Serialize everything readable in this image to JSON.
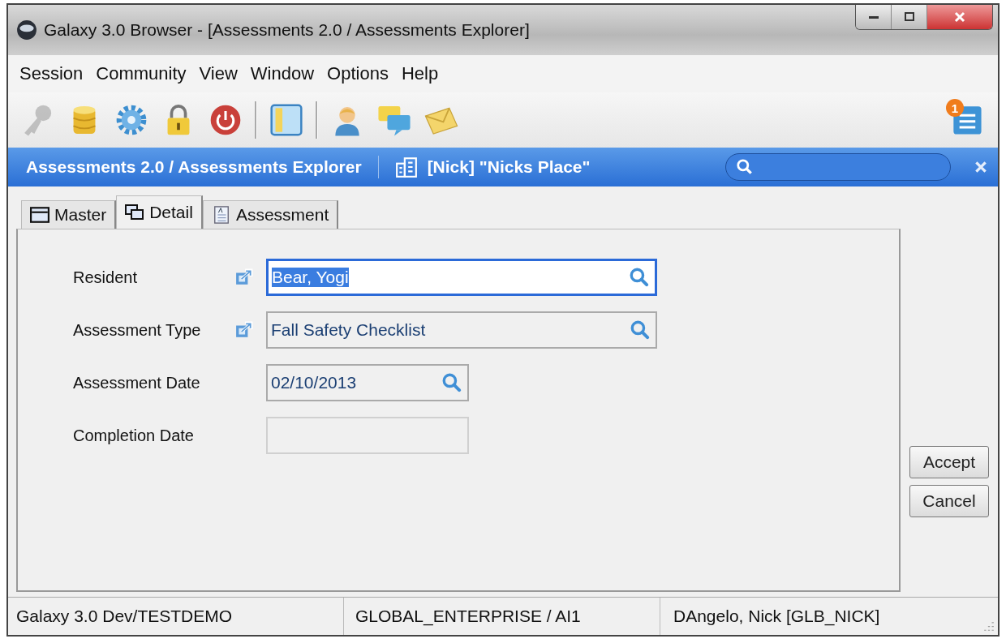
{
  "window": {
    "title": "Galaxy 3.0 Browser - [Assessments 2.0 / Assessments Explorer]"
  },
  "menu": [
    "Session",
    "Community",
    "View",
    "Window",
    "Options",
    "Help"
  ],
  "toolbar": [
    {
      "kind": "key",
      "disabled": true
    },
    {
      "kind": "database",
      "disabled": false
    },
    {
      "kind": "gear",
      "disabled": false
    },
    {
      "kind": "lock",
      "disabled": false
    },
    {
      "kind": "power",
      "disabled": false
    },
    {
      "kind": "separator"
    },
    {
      "kind": "panel",
      "disabled": false
    },
    {
      "kind": "separator"
    },
    {
      "kind": "person",
      "disabled": false
    },
    {
      "kind": "chat",
      "disabled": false
    },
    {
      "kind": "mail",
      "disabled": false
    }
  ],
  "notifications": {
    "badge": "1"
  },
  "navbar": {
    "breadcrumb": "Assessments 2.0 / Assessments Explorer",
    "facility": "[Nick] \"Nicks Place\""
  },
  "tabs": [
    {
      "label": "Master",
      "kind": "master",
      "selected": false
    },
    {
      "label": "Detail",
      "kind": "detail",
      "selected": true
    },
    {
      "label": "Assessment",
      "kind": "document",
      "selected": false
    }
  ],
  "fields": [
    {
      "label": "Resident",
      "value": "Bear, Yogi",
      "linked": true,
      "searchable": true,
      "focused": true,
      "wide": true,
      "disabled": false
    },
    {
      "label": "Assessment Type",
      "value": "Fall Safety Checklist",
      "linked": true,
      "searchable": true,
      "focused": false,
      "wide": true,
      "disabled": false
    },
    {
      "label": "Assessment Date",
      "value": "02/10/2013",
      "linked": false,
      "searchable": true,
      "focused": false,
      "wide": false,
      "disabled": false
    },
    {
      "label": "Completion Date",
      "linked": false,
      "searchable": false,
      "focused": false,
      "wide": false,
      "disabled": true
    }
  ],
  "buttons": [
    "Accept",
    "Cancel"
  ],
  "status_bar": [
    "Galaxy 3.0 Dev/TESTDEMO",
    "GLOBAL_ENTERPRISE / AI1",
    "DAngelo, Nick  [GLB_NICK]"
  ]
}
